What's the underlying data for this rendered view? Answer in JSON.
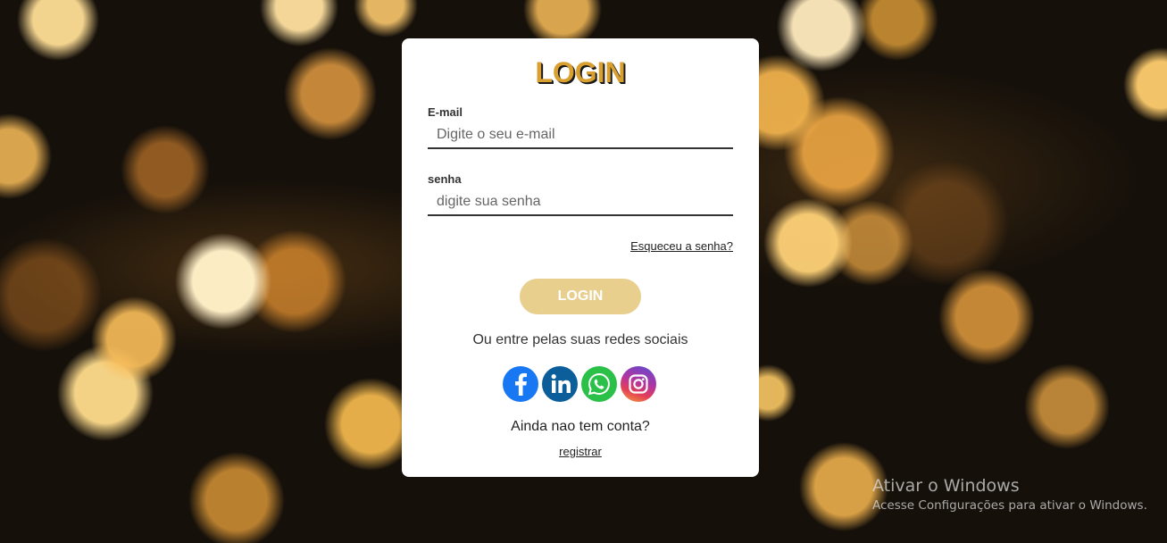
{
  "login": {
    "title": "LOGIN",
    "email_label": "E-mail",
    "email_placeholder": "Digite o seu e-mail",
    "email_value": "",
    "password_label": "senha",
    "password_placeholder": "digite sua senha",
    "password_value": "",
    "forgot_link": "Esqueceu a senha?",
    "button_label": "LOGIN",
    "social_text": "Ou entre pelas suas redes sociais",
    "socials": [
      {
        "name": "facebook",
        "icon": "facebook-icon",
        "color": "#1877f2"
      },
      {
        "name": "linkedin",
        "icon": "linkedin-icon",
        "color": "#0b5e9a"
      },
      {
        "name": "whatsapp",
        "icon": "whatsapp-icon",
        "color": "#2bc048"
      },
      {
        "name": "instagram",
        "icon": "instagram-icon",
        "color": "#b3359f"
      }
    ],
    "no_account_text": "Ainda nao tem conta?",
    "register_link": "registrar"
  },
  "watermark": {
    "line1": "Ativar o Windows",
    "line2": "Acesse Configurações para ativar o Windows."
  },
  "colors": {
    "title": "#d9a030",
    "button": "#e8cf8e",
    "card": "#ffffff"
  }
}
